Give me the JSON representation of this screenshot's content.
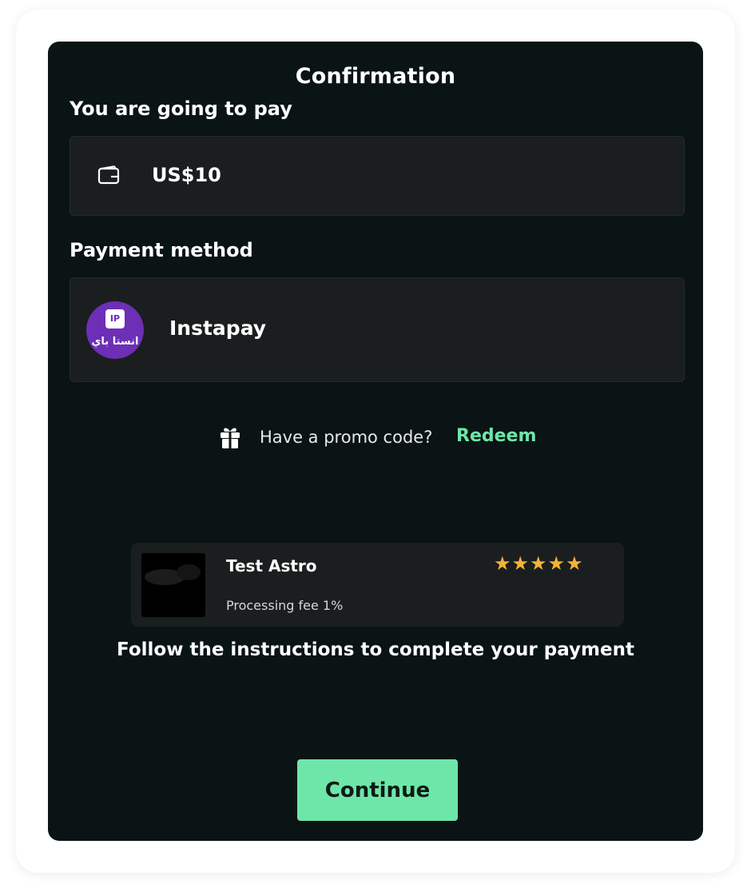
{
  "header": {
    "title": "Confirmation"
  },
  "payment": {
    "label": "You are going to pay",
    "amount": "US$10",
    "icon": "wallet-icon"
  },
  "method": {
    "label": "Payment method",
    "name": "Instapay",
    "logo_text": "انستا باي",
    "logo_badge": "IP",
    "logo_color": "#6c2fb5"
  },
  "promo": {
    "icon": "gift-icon",
    "text": "Have a promo code?",
    "action_label": "Redeem",
    "accent": "#6ee6a9"
  },
  "provider": {
    "name": "Test Astro",
    "fee": "Processing fee 1%",
    "rating": 5,
    "rating_max": 5,
    "star_color": "#f5b335"
  },
  "instructions": "Follow the instructions to complete your payment",
  "actions": {
    "continue_label": "Continue"
  },
  "colors": {
    "panel_bg": "#0a1414",
    "box_bg": "#1a1e1f",
    "accent": "#6ee6a9"
  }
}
